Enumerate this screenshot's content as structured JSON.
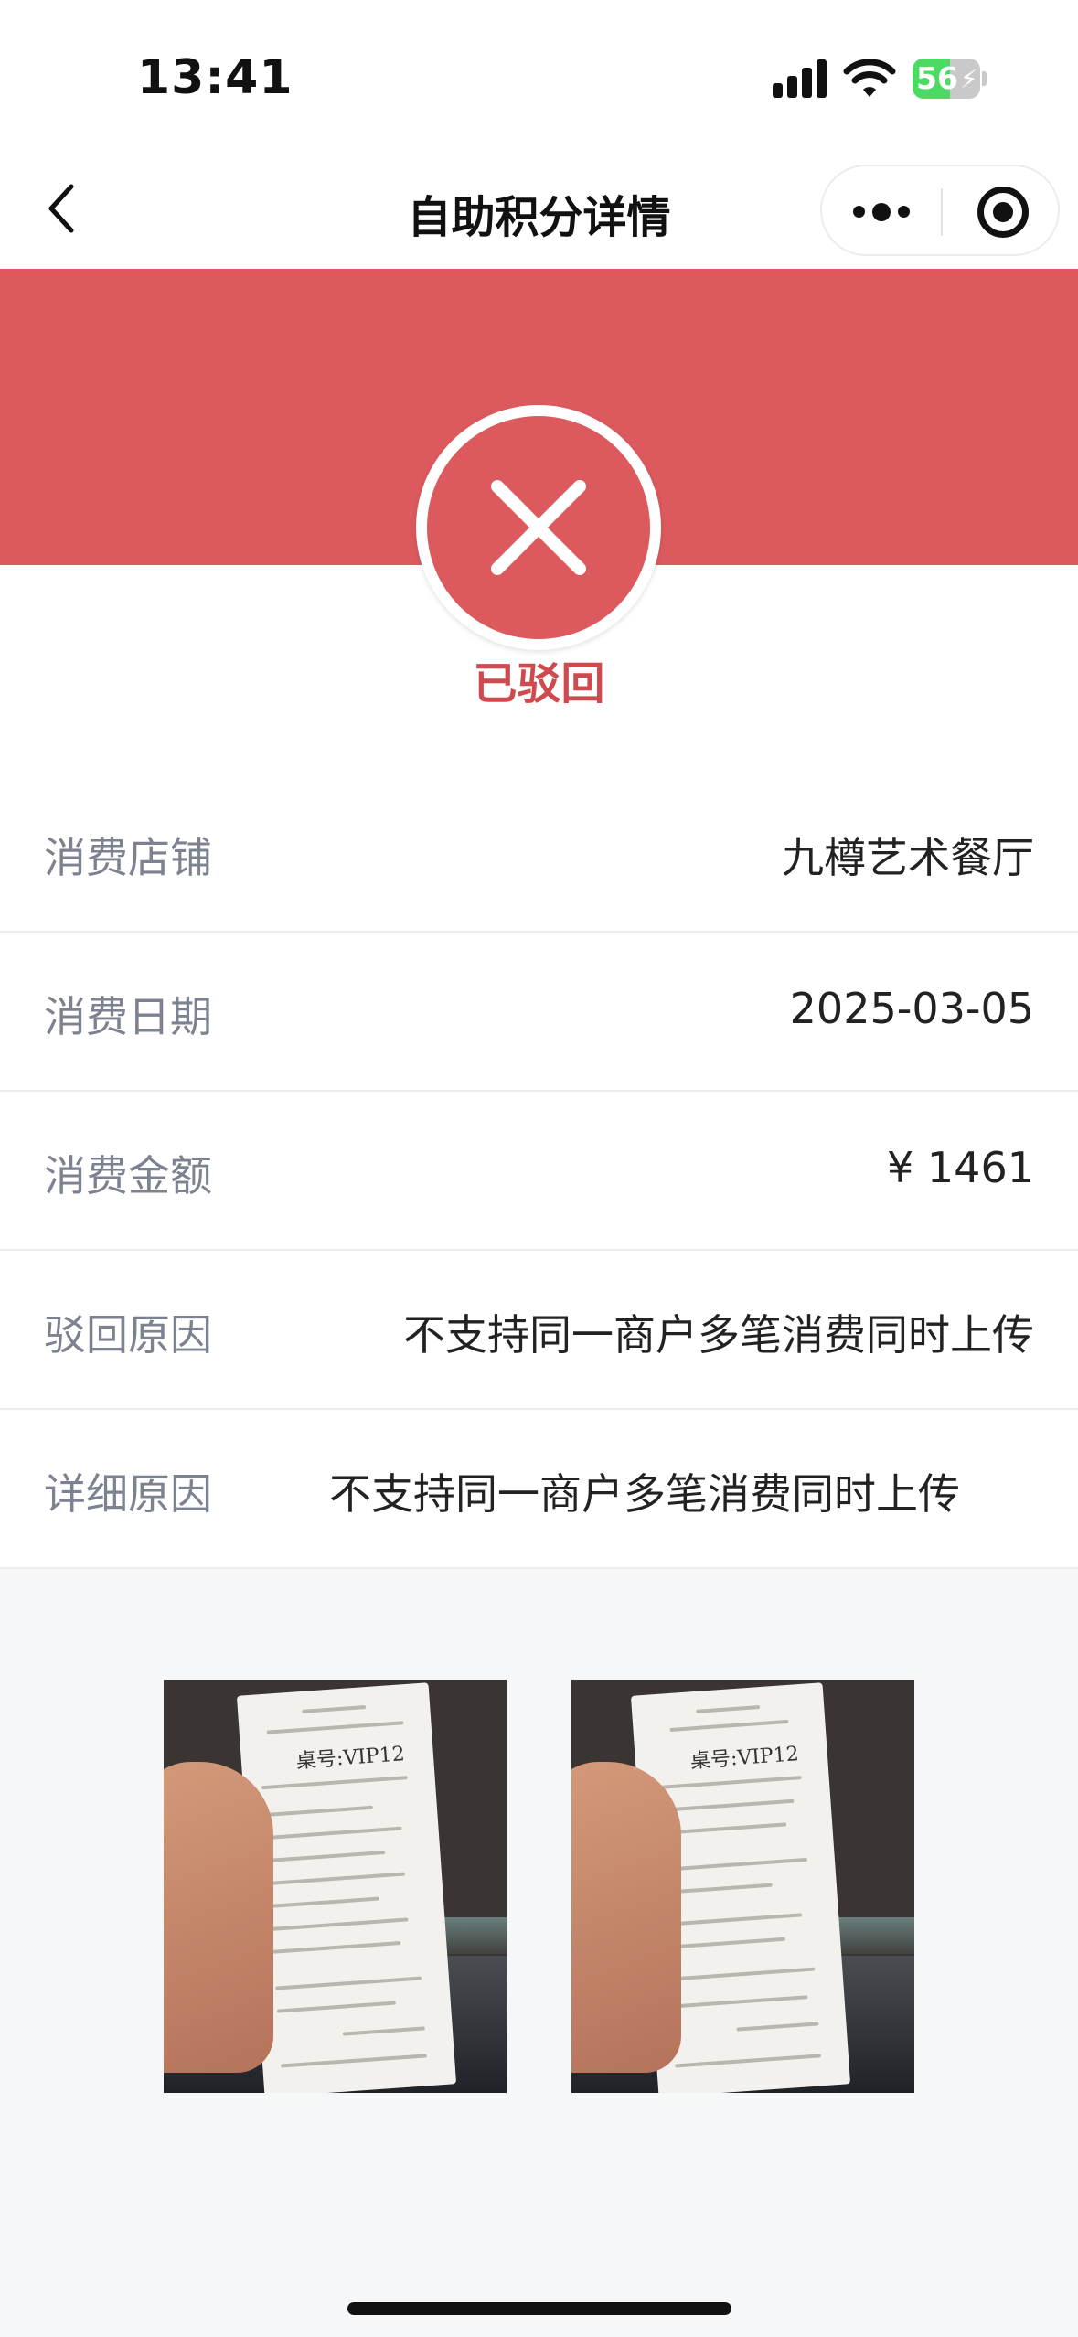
{
  "status_bar": {
    "time": "13:41",
    "battery": "56",
    "battery_level": 0.56
  },
  "nav": {
    "title": "自助积分详情"
  },
  "status": {
    "text": "已驳回"
  },
  "details": [
    {
      "label": "消费店铺",
      "value": "九樽艺术餐厅"
    },
    {
      "label": "消费日期",
      "value": "2025-03-05"
    },
    {
      "label": "消费金额",
      "value": "¥ 1461"
    },
    {
      "label": "驳回原因",
      "value": "不支持同一商户多笔消费同时上传"
    },
    {
      "label": "详细原因",
      "value": "不支持同一商户多笔消费同时上传"
    }
  ],
  "receipts": [
    {
      "table": "桌号:VIP12"
    },
    {
      "table": "桌号:VIP12"
    }
  ],
  "colors": {
    "banner": "#dc5a5e",
    "status_text": "#cf4a4e",
    "label": "#7c8290",
    "battery": "#4cd964"
  }
}
